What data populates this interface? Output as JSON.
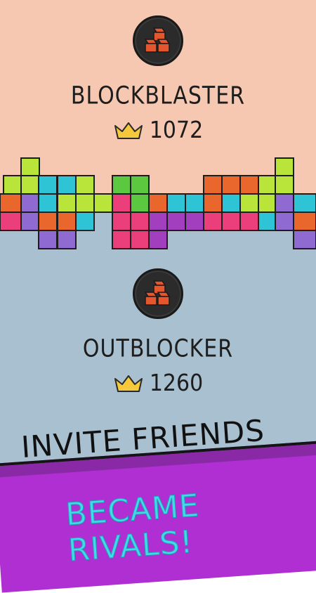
{
  "players": [
    {
      "name": "BLOCKBLASTER",
      "score": "1072",
      "avatar_icon": "cubes-icon",
      "score_icon": "crown-icon"
    },
    {
      "name": "OUTBLOCKER",
      "score": "1260",
      "avatar_icon": "cubes-icon",
      "score_icon": "crown-icon"
    }
  ],
  "promo": {
    "line1": "INVITE FRIENDS",
    "line2": "BECAME RIVALS!"
  },
  "colors": {
    "top_background": "#f7c8b1",
    "bottom_background": "#a8c0cf",
    "banner": "#b02fd3",
    "banner_text": "#45d8e8",
    "crown": "#f6c83b",
    "avatar_cubes": "#e4572e"
  }
}
